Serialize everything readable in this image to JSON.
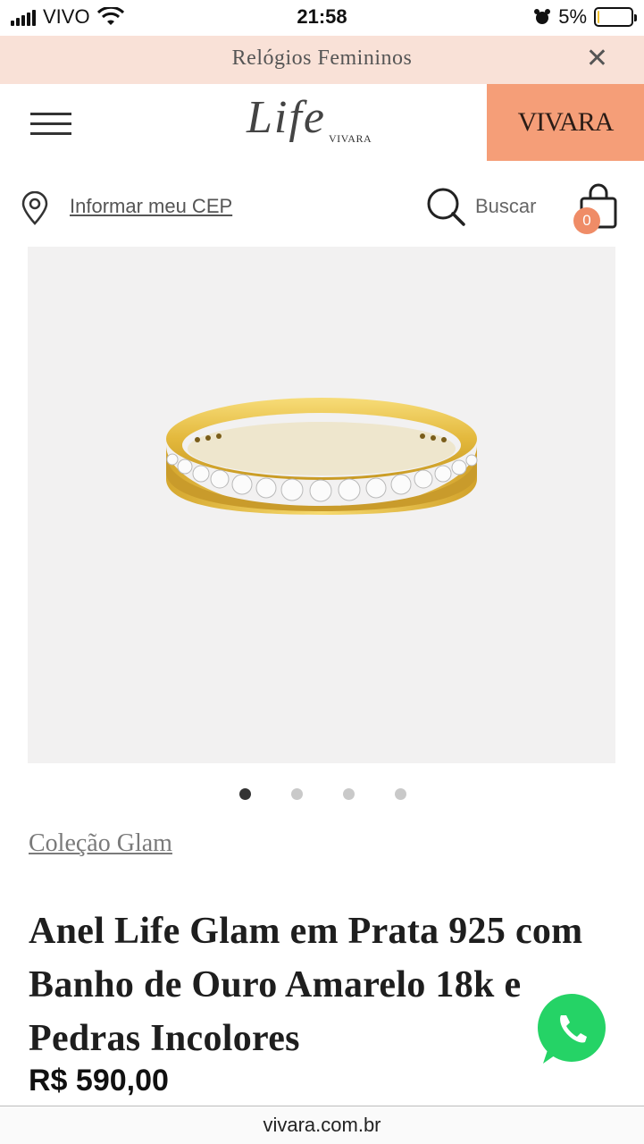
{
  "status_bar": {
    "carrier": "VIVO",
    "time": "21:58",
    "battery_percent": "5%",
    "battery_level": 0.05
  },
  "promo": {
    "text": "Relógios Femininos",
    "close_icon": "close-icon"
  },
  "header": {
    "menu_icon": "hamburger-menu-icon",
    "logo_main": "Life",
    "logo_sub": "VIVARA",
    "vivara_button": "VIVARA"
  },
  "utility": {
    "cep_label": "Informar meu CEP",
    "search_label": "Buscar",
    "cart_count": "0"
  },
  "product": {
    "carousel_total": 4,
    "carousel_active": 0,
    "collection": "Coleção Glam",
    "title": "Anel Life Glam em Prata 925 com Banho de Ouro Amarelo 18k e Pedras Incolores",
    "price": "R$ 590,00"
  },
  "browser": {
    "url": "vivara.com.br"
  },
  "colors": {
    "promo_bg": "#f9e1d7",
    "vivara_accent": "#f59e78",
    "badge": "#ef8c67",
    "whatsapp": "#25d366",
    "gold": "#e8c14a"
  }
}
